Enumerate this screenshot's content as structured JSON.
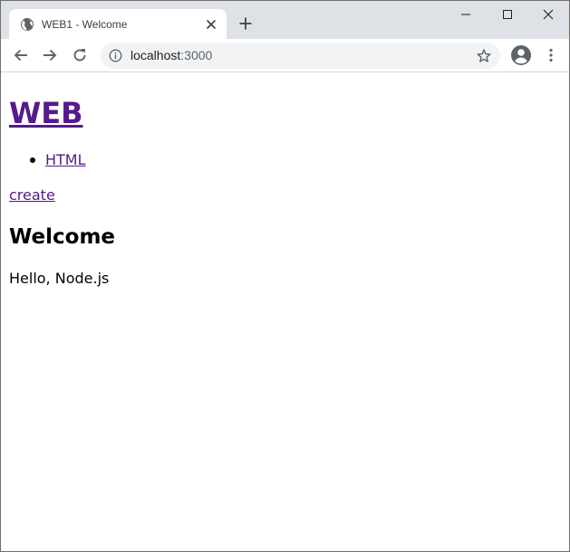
{
  "browser": {
    "tab": {
      "title": "WEB1 - Welcome",
      "favicon": "globe-icon"
    },
    "new_tab_icon": "plus-icon",
    "window_controls": [
      "minimize-icon",
      "maximize-icon",
      "close-icon"
    ],
    "address_bar": {
      "host": "localhost",
      "port": ":3000",
      "site_info_icon": "info-icon",
      "bookmark_icon": "star-icon"
    },
    "nav_icons": [
      "back-arrow-icon",
      "forward-arrow-icon",
      "reload-icon"
    ],
    "profile_icon": "account-circle-icon",
    "menu_icon": "more-vert-icon"
  },
  "page": {
    "heading_link": "WEB",
    "list": [
      {
        "label": "HTML"
      }
    ],
    "create_link": "create",
    "title": "Welcome",
    "body": "Hello, Node.js",
    "link_color": "#551a8b"
  }
}
